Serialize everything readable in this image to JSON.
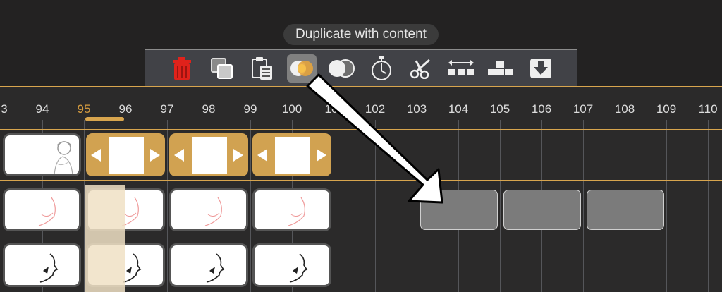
{
  "tooltip": "Duplicate with content",
  "toolbar": {
    "tools": [
      {
        "icon": "trash-icon",
        "color": "#e0221b"
      },
      {
        "icon": "duplicate-icon"
      },
      {
        "icon": "paste-icon"
      },
      {
        "icon": "duplicate-with-content-icon",
        "active": true
      },
      {
        "icon": "blend-icon"
      },
      {
        "icon": "timer-icon"
      },
      {
        "icon": "scissors-icon"
      },
      {
        "icon": "spread-frames-icon"
      },
      {
        "icon": "stack-frames-icon"
      },
      {
        "icon": "move-down-icon"
      }
    ]
  },
  "ruler": {
    "labels": [
      "3",
      "94",
      "95",
      "96",
      "97",
      "98",
      "99",
      "100",
      "10",
      "102",
      "103",
      "104",
      "105",
      "106",
      "107",
      "108",
      "109",
      "110"
    ],
    "current": "95"
  },
  "colors": {
    "accent": "#d8a54e",
    "ghost": "#7b7b7b"
  }
}
